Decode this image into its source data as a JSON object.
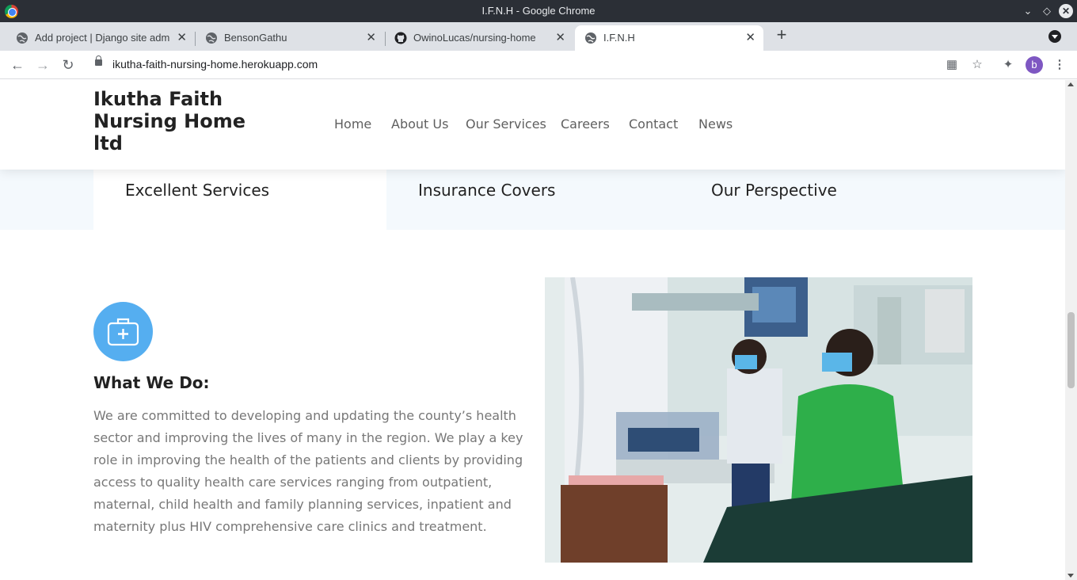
{
  "window": {
    "title": "I.F.N.H - Google Chrome"
  },
  "tabs": [
    {
      "label": "Add project | Django site adm"
    },
    {
      "label": "BensonGathu"
    },
    {
      "label": "OwinoLucas/nursing-home"
    },
    {
      "label": "I.F.N.H"
    }
  ],
  "toolbar": {
    "url": "ikutha-faith-nursing-home.herokuapp.com",
    "profile_initial": "b"
  },
  "site": {
    "brand": "Ikutha Faith Nursing Home ltd",
    "nav": [
      "Home",
      "About Us",
      "Our Services",
      "Careers",
      "Contact",
      "News"
    ],
    "feature_tabs": [
      "Excellent Services",
      "Insurance Covers",
      "Our Perspective"
    ],
    "section": {
      "title": "What We Do:",
      "body": "We are committed to developing and updating the county’s health sector and improving the lives of many in the region. We play a key role in improving the health of the patients and clients by providing access to quality health care services ranging from outpatient, maternal, child health and family planning services, inpatient and maternity plus HIV comprehensive care clinics and treatment."
    }
  },
  "colors": {
    "accent": "#55aef0",
    "titlebar": "#2b2f36",
    "tabstrip": "#dee1e6",
    "feature_strip": "#f4f9fd",
    "text_dark": "#222222",
    "text_body": "#777777"
  },
  "icons": {
    "section_icon": "medical-kit-icon",
    "photo": "nurse-and-patient-photo"
  }
}
